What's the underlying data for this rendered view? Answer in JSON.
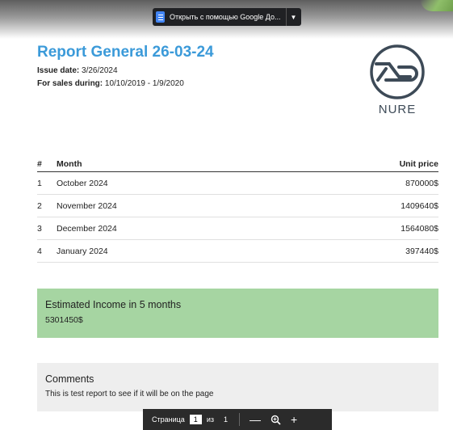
{
  "viewer": {
    "open_with_label": "Открыть с помощью Google До...",
    "page_label": "Страница",
    "current_page": "1",
    "of_label": "из",
    "total_pages": "1"
  },
  "report": {
    "title": "Report General 26-03-24",
    "issue_label": "Issue date:",
    "issue_value": "3/26/2024",
    "sales_label": "For sales during:",
    "sales_value": "10/10/2019 - 1/9/2020"
  },
  "logo": {
    "text": "NURE",
    "color": "#3d4a57"
  },
  "table": {
    "headers": {
      "num": "#",
      "month": "Month",
      "price": "Unit price"
    },
    "rows": [
      {
        "num": "1",
        "month": "October 2024",
        "price": "870000$"
      },
      {
        "num": "2",
        "month": "November 2024",
        "price": "1409640$"
      },
      {
        "num": "3",
        "month": "December 2024",
        "price": "1564080$"
      },
      {
        "num": "4",
        "month": "January 2024",
        "price": "397440$"
      }
    ]
  },
  "income": {
    "title": "Estimated Income in 5 months",
    "value": "5301450$"
  },
  "comments": {
    "title": "Comments",
    "text": "This is test report to see if it will be on the page"
  },
  "colors": {
    "title": "#3b9ad9",
    "income_bg": "#a6d5a2",
    "comments_bg": "#eeeeee",
    "toolbar_bg": "#2b2b2b"
  }
}
